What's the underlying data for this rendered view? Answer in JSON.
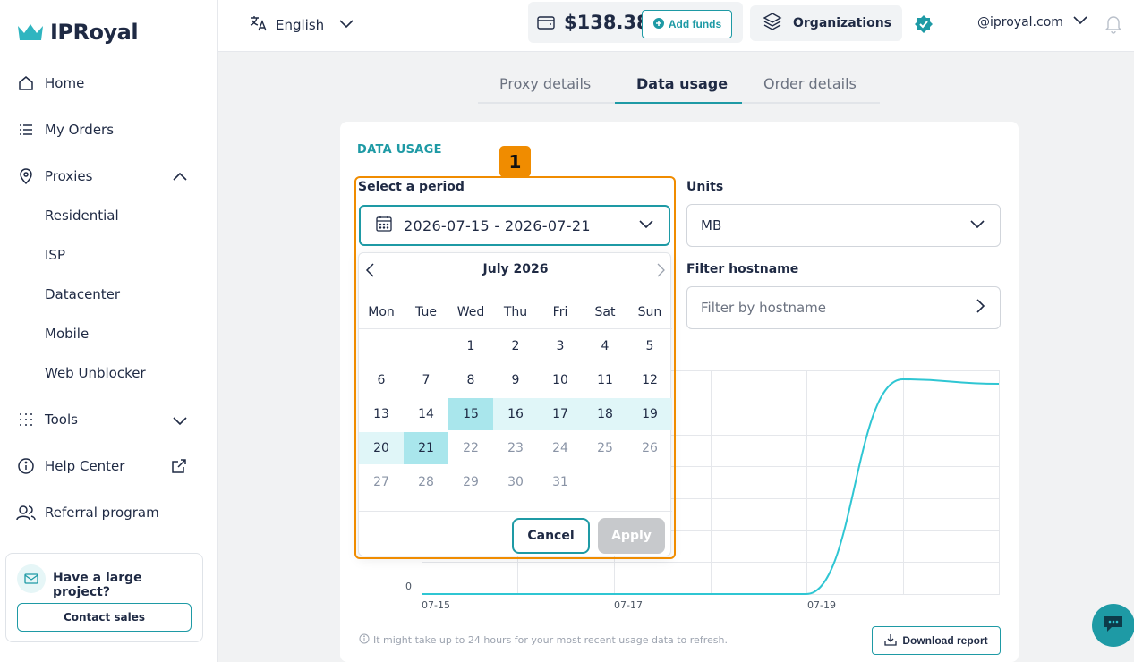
{
  "brand": {
    "name": "IPRoyal",
    "accent": "#1e9aa5",
    "highlight": "#f08c00"
  },
  "sidebar": {
    "items": [
      {
        "label": "Home",
        "icon": "home-icon"
      },
      {
        "label": "My Orders",
        "icon": "list-icon"
      },
      {
        "label": "Proxies",
        "icon": "location-pin-icon"
      },
      {
        "label": "Tools",
        "icon": "grid-dots-icon"
      },
      {
        "label": "Help Center",
        "icon": "info-icon"
      },
      {
        "label": "Referral program",
        "icon": "users-icon"
      }
    ],
    "proxy_subitems": [
      "Residential",
      "ISP",
      "Datacenter",
      "Mobile",
      "Web Unblocker"
    ],
    "promo": {
      "title": "Have a large project?",
      "button": "Contact sales"
    }
  },
  "topbar": {
    "language": "English",
    "balance": "$138.38",
    "add_funds": "Add funds",
    "organizations": "Organizations",
    "email": "@iproyal.com"
  },
  "tabs": [
    {
      "label": "Proxy details",
      "active": false
    },
    {
      "label": "Data usage",
      "active": true
    },
    {
      "label": "Order details",
      "active": false
    }
  ],
  "card": {
    "title": "DATA USAGE",
    "period_label": "Select a period",
    "period_value": "2026-07-15 - 2026-07-21",
    "units_label": "Units",
    "units_value": "MB",
    "hostname_label": "Filter hostname",
    "hostname_placeholder": "Filter by hostname",
    "footnote": "It might take up to 24 hours for your most recent usage data to refresh.",
    "download": "Download report"
  },
  "calendar": {
    "month": "July 2026",
    "weekdays": [
      "Mon",
      "Tue",
      "Wed",
      "Thu",
      "Fri",
      "Sat",
      "Sun"
    ],
    "weeks": [
      [
        "",
        "",
        "1",
        "2",
        "3",
        "4",
        "5"
      ],
      [
        "6",
        "7",
        "8",
        "9",
        "10",
        "11",
        "12"
      ],
      [
        "13",
        "14",
        "15",
        "16",
        "17",
        "18",
        "19"
      ],
      [
        "20",
        "21",
        "22",
        "23",
        "24",
        "25",
        "26"
      ],
      [
        "27",
        "28",
        "29",
        "30",
        "31",
        "",
        ""
      ]
    ],
    "range_start": 15,
    "range_end": 21,
    "disabled_after": 21,
    "cancel": "Cancel",
    "apply": "Apply"
  },
  "annotation": {
    "marker": "1"
  },
  "chart_data": {
    "type": "line",
    "x": [
      "07-15",
      "07-16",
      "07-17",
      "07-18",
      "07-19",
      "07-20",
      "07-21"
    ],
    "x_tick_labels": [
      "07-15",
      "07-17",
      "07-19"
    ],
    "y_tick_labels": [
      "0"
    ],
    "series": [
      {
        "values": [
          0,
          0,
          0,
          0,
          0,
          0.96,
          0.94
        ]
      }
    ],
    "grid": true
  }
}
